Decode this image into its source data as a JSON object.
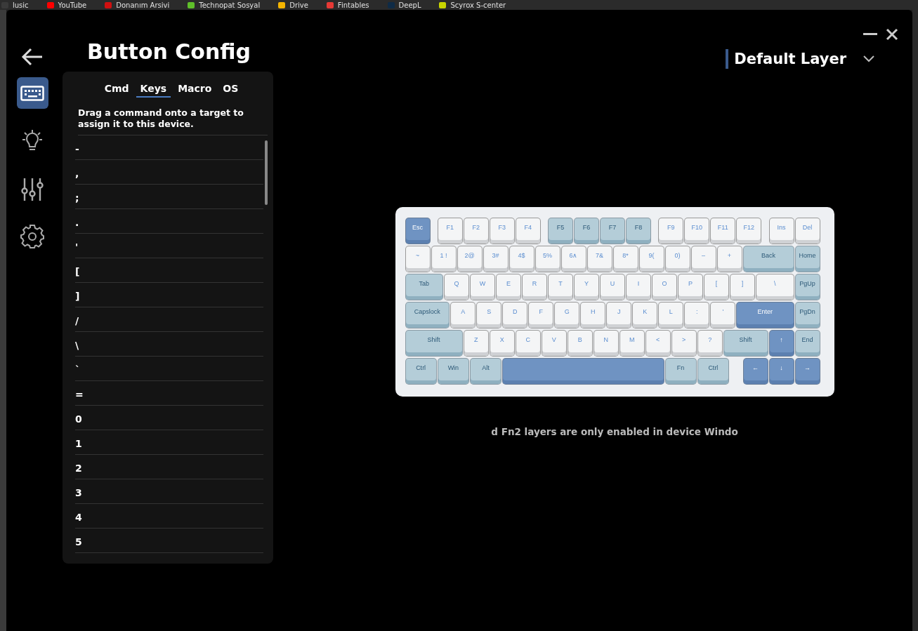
{
  "bookmarks": [
    {
      "label": "lusic",
      "color": "#3a3a3a"
    },
    {
      "label": "YouTube",
      "color": "#ff0000"
    },
    {
      "label": "Donanım Arsivi",
      "color": "#d01010"
    },
    {
      "label": "Technopat Sosyal",
      "color": "#5fbf2a"
    },
    {
      "label": "Drive",
      "color": "#f4b400"
    },
    {
      "label": "Fintables",
      "color": "#e53935"
    },
    {
      "label": "DeepL",
      "color": "#0f2b46"
    },
    {
      "label": "Scyrox S-center",
      "color": "#c8d400"
    }
  ],
  "nav": [
    {
      "kind": "keyboard",
      "selected": true
    },
    {
      "kind": "bulb",
      "selected": false
    },
    {
      "kind": "sliders",
      "selected": false
    },
    {
      "kind": "gear",
      "selected": false
    }
  ],
  "title": "Button Config",
  "layer": {
    "label": "Default Layer"
  },
  "tabs": [
    {
      "label": "Cmd",
      "selected": false
    },
    {
      "label": "Keys",
      "selected": true
    },
    {
      "label": "Macro",
      "selected": false
    },
    {
      "label": "OS",
      "selected": false
    }
  ],
  "instruction": "Drag a command onto a target to assign it to this device.",
  "commands": [
    "-",
    ",",
    ";",
    ".",
    "'",
    "[",
    "]",
    "/",
    "\\",
    "`",
    "=",
    "0",
    "1",
    "2",
    "3",
    "4",
    "5"
  ],
  "keyboard": {
    "rows": [
      {
        "keys": [
          {
            "label": "Esc",
            "kind": "accent"
          },
          {
            "label": "F1",
            "kind": "light"
          },
          {
            "label": "F2",
            "kind": "light"
          },
          {
            "label": "F3",
            "kind": "light"
          },
          {
            "label": "F4",
            "kind": "light"
          },
          {
            "label": "F5",
            "kind": "mod"
          },
          {
            "label": "F6",
            "kind": "mod"
          },
          {
            "label": "F7",
            "kind": "mod"
          },
          {
            "label": "F8",
            "kind": "mod"
          },
          {
            "label": "F9",
            "kind": "light"
          },
          {
            "label": "F10",
            "kind": "light"
          },
          {
            "label": "F11",
            "kind": "light"
          },
          {
            "label": "F12",
            "kind": "light"
          },
          {
            "label": "Ins",
            "kind": "light"
          },
          {
            "label": "Del",
            "kind": "light"
          }
        ]
      },
      {
        "keys": [
          {
            "label": "~",
            "kind": "light"
          },
          {
            "label": "1 !",
            "kind": "light"
          },
          {
            "label": "2@",
            "kind": "light"
          },
          {
            "label": "3#",
            "kind": "light"
          },
          {
            "label": "4$",
            "kind": "light"
          },
          {
            "label": "5%",
            "kind": "light"
          },
          {
            "label": "6∧",
            "kind": "light"
          },
          {
            "label": "7&",
            "kind": "light"
          },
          {
            "label": "8*",
            "kind": "light"
          },
          {
            "label": "9(",
            "kind": "light"
          },
          {
            "label": "0)",
            "kind": "light"
          },
          {
            "label": "–",
            "kind": "light"
          },
          {
            "label": "+",
            "kind": "light"
          },
          {
            "label": "Back",
            "kind": "mod"
          },
          {
            "label": "Home",
            "kind": "mod"
          }
        ]
      },
      {
        "keys": [
          {
            "label": "Tab",
            "kind": "mod"
          },
          {
            "label": "Q",
            "kind": "light"
          },
          {
            "label": "W",
            "kind": "light"
          },
          {
            "label": "E",
            "kind": "light"
          },
          {
            "label": "R",
            "kind": "light"
          },
          {
            "label": "T",
            "kind": "light"
          },
          {
            "label": "Y",
            "kind": "light"
          },
          {
            "label": "U",
            "kind": "light"
          },
          {
            "label": "I",
            "kind": "light"
          },
          {
            "label": "O",
            "kind": "light"
          },
          {
            "label": "P",
            "kind": "light"
          },
          {
            "label": "[",
            "kind": "light"
          },
          {
            "label": "]",
            "kind": "light"
          },
          {
            "label": "\\",
            "kind": "light"
          },
          {
            "label": "PgUp",
            "kind": "mod"
          }
        ]
      },
      {
        "keys": [
          {
            "label": "Capslock",
            "kind": "mod"
          },
          {
            "label": "A",
            "kind": "light"
          },
          {
            "label": "S",
            "kind": "light"
          },
          {
            "label": "D",
            "kind": "light"
          },
          {
            "label": "F",
            "kind": "light"
          },
          {
            "label": "G",
            "kind": "light"
          },
          {
            "label": "H",
            "kind": "light"
          },
          {
            "label": "J",
            "kind": "light"
          },
          {
            "label": "K",
            "kind": "light"
          },
          {
            "label": "L",
            "kind": "light"
          },
          {
            "label": ":",
            "kind": "light"
          },
          {
            "label": "'",
            "kind": "light"
          },
          {
            "label": "Enter",
            "kind": "accent"
          },
          {
            "label": "PgDn",
            "kind": "mod"
          }
        ]
      },
      {
        "keys": [
          {
            "label": "Shift",
            "kind": "mod"
          },
          {
            "label": "Z",
            "kind": "light"
          },
          {
            "label": "X",
            "kind": "light"
          },
          {
            "label": "C",
            "kind": "light"
          },
          {
            "label": "V",
            "kind": "light"
          },
          {
            "label": "B",
            "kind": "light"
          },
          {
            "label": "N",
            "kind": "light"
          },
          {
            "label": "M",
            "kind": "light"
          },
          {
            "label": "<",
            "kind": "light"
          },
          {
            "label": ">",
            "kind": "light"
          },
          {
            "label": "?",
            "kind": "light"
          },
          {
            "label": "Shift",
            "kind": "mod"
          },
          {
            "label": "↑",
            "kind": "accent"
          },
          {
            "label": "End",
            "kind": "mod"
          }
        ]
      },
      {
        "keys": [
          {
            "label": "Ctrl",
            "kind": "mod"
          },
          {
            "label": "Win",
            "kind": "mod"
          },
          {
            "label": "Alt",
            "kind": "mod"
          },
          {
            "kind": "accent"
          },
          {
            "label": "Fn",
            "kind": "mod"
          },
          {
            "label": "Ctrl",
            "kind": "mod"
          },
          {
            "label": "←",
            "kind": "accent"
          },
          {
            "label": "↓",
            "kind": "accent"
          },
          {
            "label": "→",
            "kind": "accent"
          }
        ]
      }
    ]
  },
  "notice": "d Fn2 layers are only enabled in device Windo"
}
